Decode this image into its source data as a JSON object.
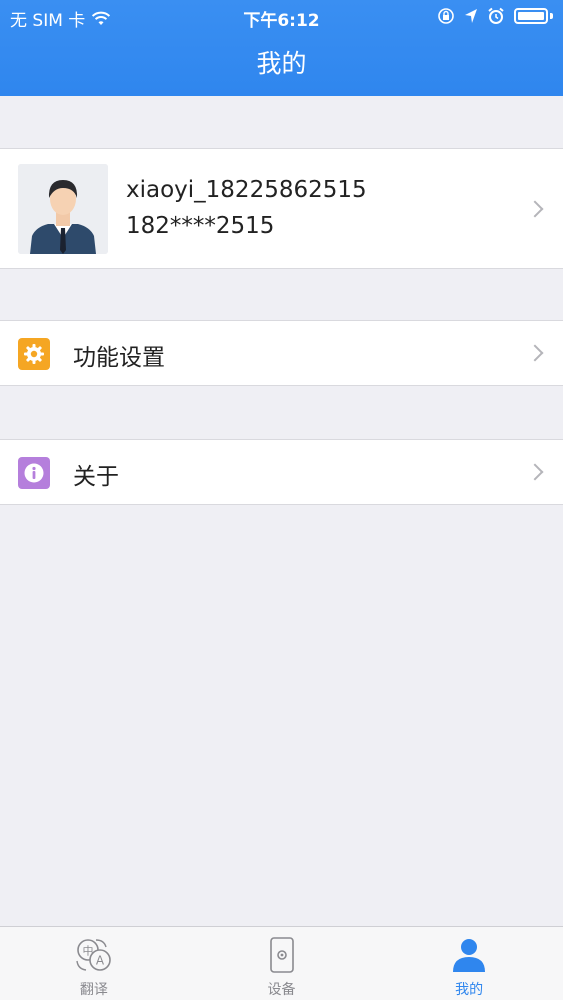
{
  "status_bar": {
    "carrier": "无 SIM 卡",
    "time": "下午6:12"
  },
  "header": {
    "title": "我的"
  },
  "profile": {
    "username": "xiaoyi_18225862515",
    "phone": "182****2515",
    "avatar_icon": "user-avatar-icon"
  },
  "menu": {
    "settings_label": "功能设置",
    "settings_icon": "gear-icon",
    "settings_color": "#f5a623",
    "about_label": "关于",
    "about_icon": "info-icon",
    "about_color": "#b57fdc"
  },
  "tabbar": {
    "tabs": [
      {
        "label": "翻译",
        "icon": "translate-icon",
        "active": false
      },
      {
        "label": "设备",
        "icon": "device-icon",
        "active": false
      },
      {
        "label": "我的",
        "icon": "user-icon",
        "active": true
      }
    ],
    "active_color": "#2f86ee",
    "inactive_color": "#8a8a8f"
  },
  "colors": {
    "header_blue": "#2f86ee",
    "background": "#efeff4"
  }
}
